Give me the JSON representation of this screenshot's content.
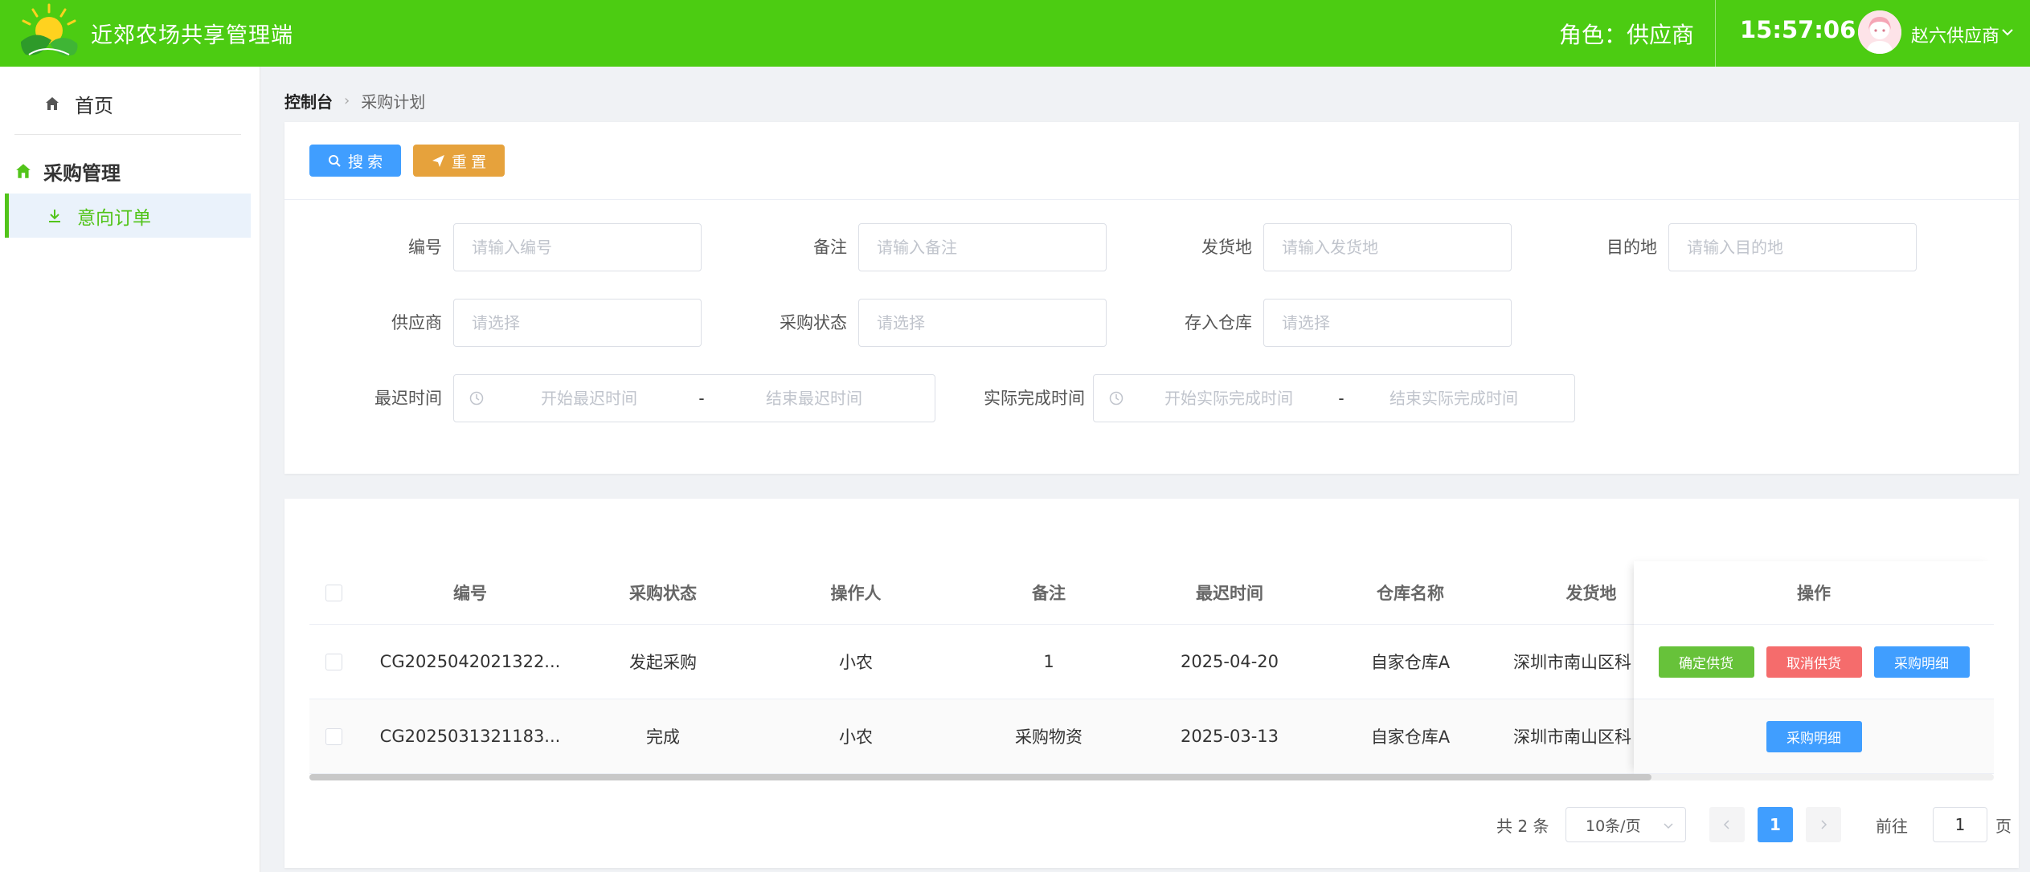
{
  "header": {
    "app_title": "近郊农场共享管理端",
    "role_text": "角色：供应商",
    "time": "15:57:06",
    "user_name": "赵六供应商"
  },
  "sidebar": {
    "home_label": "首页",
    "group_label": "采购管理",
    "active_item_label": "意向订单"
  },
  "breadcrumb": {
    "root": "控制台",
    "current": "采购计划"
  },
  "search": {
    "search_btn": "搜 索",
    "reset_btn": "重 置",
    "fields": {
      "code": {
        "label": "编号",
        "placeholder": "请输入编号"
      },
      "remark": {
        "label": "备注",
        "placeholder": "请输入备注"
      },
      "origin": {
        "label": "发货地",
        "placeholder": "请输入发货地"
      },
      "destination": {
        "label": "目的地",
        "placeholder": "请输入目的地"
      },
      "supplier": {
        "label": "供应商",
        "placeholder": "请选择"
      },
      "status": {
        "label": "采购状态",
        "placeholder": "请选择"
      },
      "warehouse": {
        "label": "存入仓库",
        "placeholder": "请选择"
      },
      "latest_time": {
        "label": "最迟时间",
        "start_placeholder": "开始最迟时间",
        "end_placeholder": "结束最迟时间",
        "separator": "-"
      },
      "actual_time": {
        "label": "实际完成时间",
        "start_placeholder": "开始实际完成时间",
        "end_placeholder": "结束实际完成时间",
        "separator": "-"
      }
    }
  },
  "table": {
    "columns": [
      "编号",
      "采购状态",
      "操作人",
      "备注",
      "最迟时间",
      "仓库名称",
      "发货地"
    ],
    "action_column": "操作",
    "rows": [
      {
        "code": "CG2025042021322...",
        "status": "发起采购",
        "operator": "小农",
        "remark": "1",
        "deadline": "2025-04-20",
        "warehouse": "自家仓库A",
        "origin": "深圳市南山区科"
      },
      {
        "code": "CG2025031321183...",
        "status": "完成",
        "operator": "小农",
        "remark": "采购物资",
        "deadline": "2025-03-13",
        "warehouse": "自家仓库A",
        "origin": "深圳市南山区科"
      }
    ],
    "actions": {
      "confirm": "确定供货",
      "cancel": "取消供货",
      "detail": "采购明细"
    }
  },
  "pagination": {
    "total": "共 2 条",
    "page_size": "10条/页",
    "current_page": "1",
    "goto_label": "前往",
    "goto_value": "1",
    "page_unit": "页"
  },
  "colors": {
    "header_bg": "#4ccc12",
    "primary": "#409eff",
    "warning": "#e6a23c",
    "success": "#67c23a",
    "danger": "#f56c6c",
    "sidebar_active": "#52c41a"
  }
}
